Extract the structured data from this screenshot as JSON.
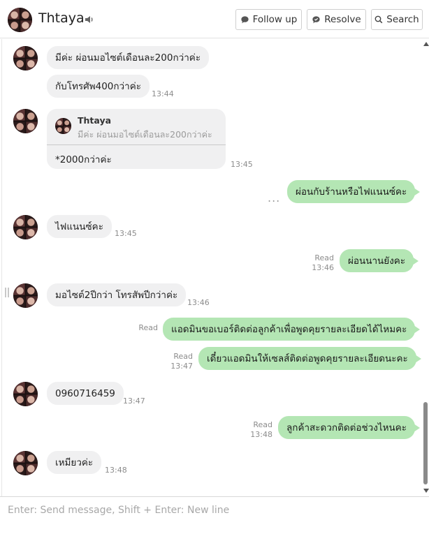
{
  "header": {
    "contact_name": "Thtaya",
    "follow_up_label": "Follow up",
    "resolve_label": "Resolve",
    "search_label": "Search"
  },
  "messages": [
    {
      "direction": "in",
      "text": "มีค่ะ ผ่อนมอไซต์เดือนละ200กว่าค่ะ"
    },
    {
      "direction": "in",
      "text": "กับโทรศัพ400กว่าค่ะ",
      "time": "13:44"
    },
    {
      "direction": "in",
      "reply_to": {
        "name": "Thtaya",
        "text": "มีค่ะ ผ่อนมอไซต์เดือนละ200กว่าค่ะ"
      },
      "text": "*2000กว่าค่ะ",
      "time": "13:45"
    },
    {
      "direction": "out",
      "text": "ผ่อนกับร้านหรือไฟแนนซ์คะ",
      "pending": "..."
    },
    {
      "direction": "in",
      "text": "ไฟแนนซ์คะ",
      "time": "13:45"
    },
    {
      "direction": "out",
      "text": "ผ่อนนานยังคะ",
      "status": "Read",
      "time": "13:46"
    },
    {
      "direction": "in",
      "text": "มอไซต์2ปีกว่า โทรสัพปีกว่าค่ะ",
      "time": "13:46"
    },
    {
      "direction": "out",
      "text": "แอดมินขอเบอร์ติดต่อลูกค้าเพื่อพูดคุยรายละเอียดได้ไหมคะ",
      "status": "Read"
    },
    {
      "direction": "out",
      "text": "เดี๋ยวแอดมินให้เซลส์ติดต่อพูดคุยรายละเอียดนะคะ",
      "status": "Read",
      "time": "13:47"
    },
    {
      "direction": "in",
      "text": "0960716459",
      "time": "13:47"
    },
    {
      "direction": "out",
      "text": "ลูกค้าสะดวกติดต่อช่วงไหนคะ",
      "status": "Read",
      "time": "13:48"
    },
    {
      "direction": "in",
      "text": "เหมียวค่ะ",
      "time": "13:48"
    }
  ],
  "composer": {
    "placeholder": "Enter: Send message, Shift + Enter: New line"
  },
  "colors": {
    "incoming_bubble": "#f0f0f1",
    "outgoing_bubble": "#b4e6b4",
    "timestamp": "#8c8c8c"
  },
  "icons": [
    "speaker-icon",
    "comment-icon",
    "resolve-icon",
    "search-icon"
  ]
}
